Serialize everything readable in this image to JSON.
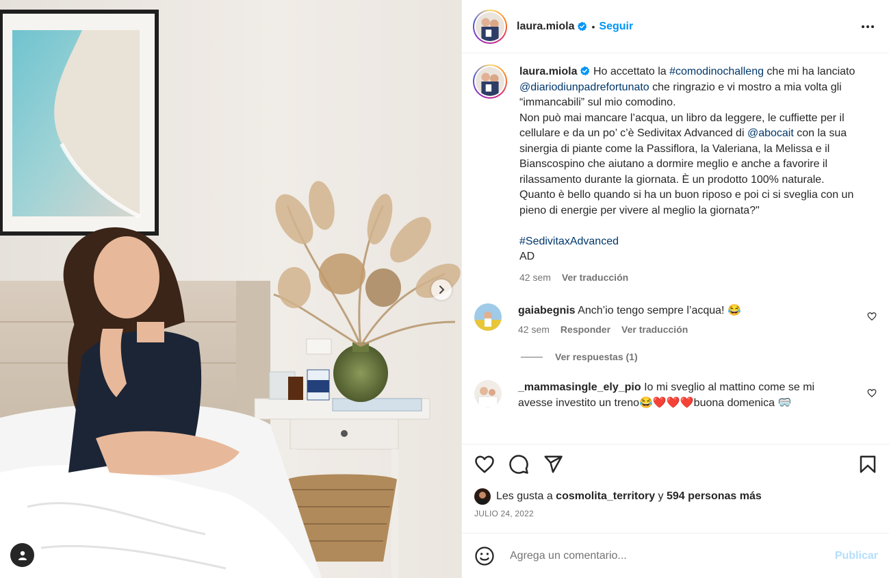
{
  "post": {
    "username": "laura.miola",
    "follow_label": "Seguir",
    "separator": "•",
    "caption": {
      "username": "laura.miola",
      "p1_a": "Ho accettato la ",
      "p1_hashtag": "#comodinochalleng",
      "p1_b": " che mi ha lanciato ",
      "p1_mention": "@diariodiunpadrefortunato",
      "p1_c": " che ringrazio e vi mostro a mia volta gli “immancabili” sul mio comodino.",
      "p2_a": "Non può mai mancare l’acqua, un libro da leggere, le cuffiette per il cellulare e da un po’ c’è Sedivitax Advanced di ",
      "p2_mention": "@abocait",
      "p2_b": " con la sua sinergia di piante come la Passiflora, la Valeriana, la Melissa e il Bianscospino che aiutano a dormire meglio e anche a favorire il rilassamento durante la giornata. È un prodotto 100% naturale.",
      "p3": "Quanto è bello quando si ha un buon riposo e poi ci si sveglia con un pieno di energie per vivere al meglio la giornata?\"",
      "hashtag": "#SedivitaxAdvanced",
      "ad": "AD",
      "time": "42 sem",
      "translate": "Ver traducción"
    },
    "comments": [
      {
        "username": "gaiabegnis",
        "text": "Anch’io tengo sempre l’acqua! 😂",
        "time": "42 sem",
        "reply": "Responder",
        "translate": "Ver traducción",
        "view_replies": "Ver respuestas (1)"
      },
      {
        "username": "_mammasingle_ely_pio",
        "text": "Io mi sveglio al mattino come se mi avesse investito un treno😂❤️❤️❤️buona domenica 🥽"
      }
    ],
    "likes": {
      "prefix": "Les gusta a ",
      "user": "cosmolita_territory",
      "middle": " y ",
      "others": "594 personas más"
    },
    "date": "JULIO 24, 2022",
    "comment_input": {
      "placeholder": "Agrega un comentario...",
      "value": ""
    },
    "publish_label": "Publicar"
  },
  "colors": {
    "accent": "#0095f6",
    "link": "#00376b",
    "muted": "#737373",
    "publish_disabled": "#b2dffc"
  },
  "icons": {
    "verified": "verified-badge-icon",
    "more": "more-options-icon",
    "like": "heart-icon",
    "comment": "comment-icon",
    "share": "send-icon",
    "save": "bookmark-icon",
    "emoji": "emoji-icon",
    "next": "chevron-right-icon",
    "tags": "user-tag-icon"
  }
}
